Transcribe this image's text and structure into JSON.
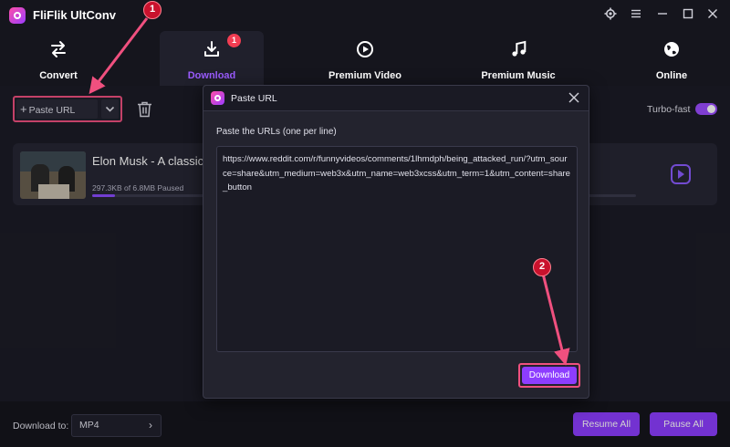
{
  "app": {
    "title": "FliFlik UltConv"
  },
  "nav": {
    "tabs": [
      {
        "label": "Convert",
        "icon": "convert-arrows-icon"
      },
      {
        "label": "Download",
        "icon": "download-icon",
        "active": true,
        "badge": "1"
      },
      {
        "label": "Premium Video",
        "icon": "play-circle-icon"
      },
      {
        "label": "Premium Music",
        "icon": "music-note-icon"
      },
      {
        "label": "Online",
        "icon": "globe-icon"
      }
    ]
  },
  "toolbar": {
    "paste_plus": "+",
    "paste_label": "Paste URL",
    "turbo_label": "Turbo-fast",
    "turbo_on": true
  },
  "download_item": {
    "title": "Elon Musk - A classic",
    "meta": "297.3KB of 6.8MB Paused",
    "progress": 0.0427
  },
  "footer": {
    "download_to_label": "Download to:",
    "format_value": "MP4",
    "resume_all": "Resume All",
    "pause_all": "Pause All"
  },
  "modal": {
    "title": "Paste URL",
    "prompt": "Paste the URLs (one per line)",
    "url_text": "https://www.reddit.com/r/funnyvideos/comments/1lhmdph/being_attacked_run/?utm_source=share&utm_medium=web3x&utm_name=web3xcss&utm_term=1&utm_content=share_button",
    "download_button": "Download"
  },
  "annotations": {
    "step1": "1",
    "step2": "2"
  },
  "colors": {
    "accent": "#8d3dff",
    "highlight": "#f0507f",
    "badge": "#f23d52",
    "background": "#14141c"
  }
}
